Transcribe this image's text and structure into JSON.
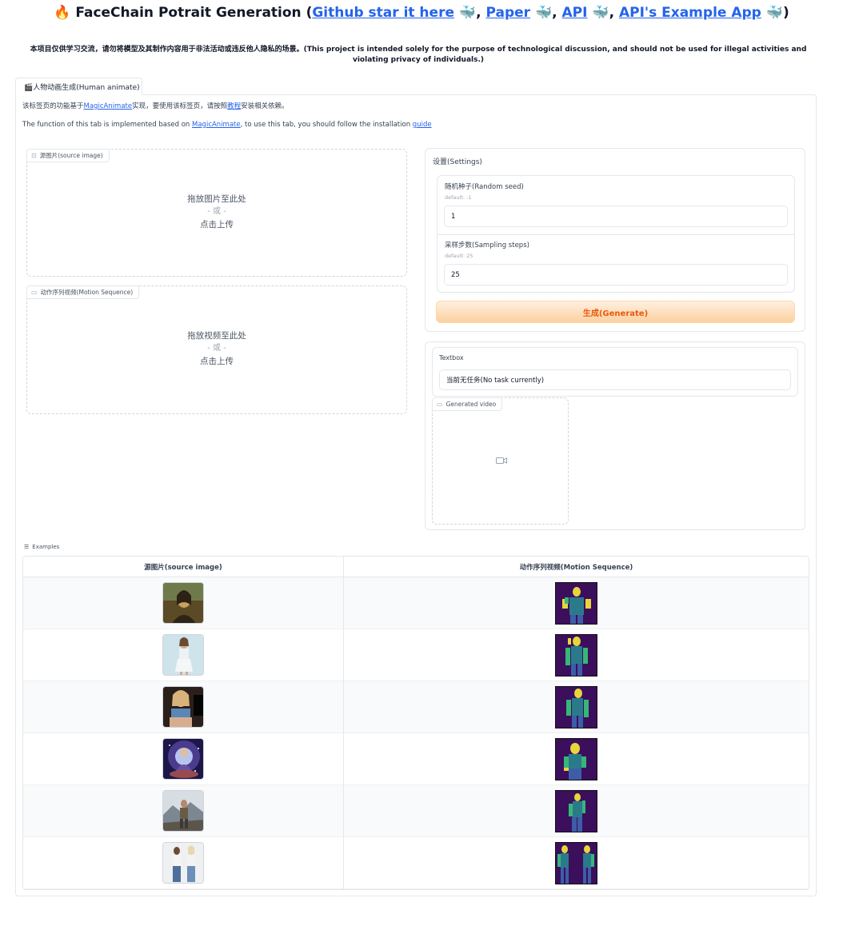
{
  "header": {
    "fire_emoji": "🔥",
    "title_text": "FaceChain Potrait Generation (",
    "links": [
      "Github star it here",
      "Paper",
      "API",
      "API's Example App"
    ],
    "whale": "🐳",
    "separator": ", ",
    "close_paren": ")"
  },
  "disclaimer": "本项目仅供学习交流，请勿将模型及其制作内容用于非法活动或违反他人隐私的场景。(This project is intended solely for the purpose of technological discussion, and should not be used for illegal activities and violating privacy of individuals.)",
  "tabs": [
    {
      "icon": "🎬",
      "label": "人物动画生成(Human animate)"
    }
  ],
  "intro": {
    "zh_prefix": "该标签页的功能基于",
    "zh_link": "MagicAnimate",
    "zh_middle": "实现，要使用该标签页，请按照",
    "zh_link2": "教程",
    "zh_suffix": "安装相关依赖。",
    "en_prefix": "The function of this tab is implemented based on ",
    "en_link": "MagicAnimate",
    "en_middle": ", to use this tab, you should follow the installation ",
    "en_link2": "guide"
  },
  "source_image": {
    "label": "源图片(source image)",
    "drop_text": "拖放图片至此处",
    "or_text": "- 或 -",
    "click_text": "点击上传"
  },
  "motion_sequence": {
    "label": "动作序列视频(Motion Sequence)",
    "drop_text": "拖放视频至此处",
    "or_text": "- 或 -",
    "click_text": "点击上传"
  },
  "settings": {
    "title": "设置(Settings)",
    "seed_label": "随机种子(Random seed)",
    "seed_info": "default: -1",
    "seed_value": "1",
    "steps_label": "采样步数(Sampling steps)",
    "steps_info": "default: 25",
    "steps_value": "25",
    "generate_label": "生成(Generate)"
  },
  "output": {
    "textbox_label": "Textbox",
    "textbox_value": "当前无任务(No task currently)",
    "video_label": "Generated video"
  },
  "examples": {
    "label": "Examples",
    "headers": [
      "源图片(source image)",
      "动作序列视频(Motion Sequence)"
    ],
    "rows": [
      {
        "source": "mona-lisa-thumbnail",
        "motion": "densepose-thumbnail"
      },
      {
        "source": "woman-white-dress-thumbnail",
        "motion": "densepose-thumbnail"
      },
      {
        "source": "woman-blue-top-thumbnail",
        "motion": "densepose-thumbnail"
      },
      {
        "source": "cosmic-meditation-thumbnail",
        "motion": "densepose-thumbnail"
      },
      {
        "source": "man-mountains-thumbnail",
        "motion": "densepose-thumbnail"
      },
      {
        "source": "two-women-thumbnail",
        "motion": "densepose-thumbnail"
      }
    ]
  },
  "colors": {
    "link": "#2563eb",
    "generate_text": "#ea580c",
    "generate_bg": "#fbd09f",
    "densepose_bg": "#3b0f5c"
  }
}
